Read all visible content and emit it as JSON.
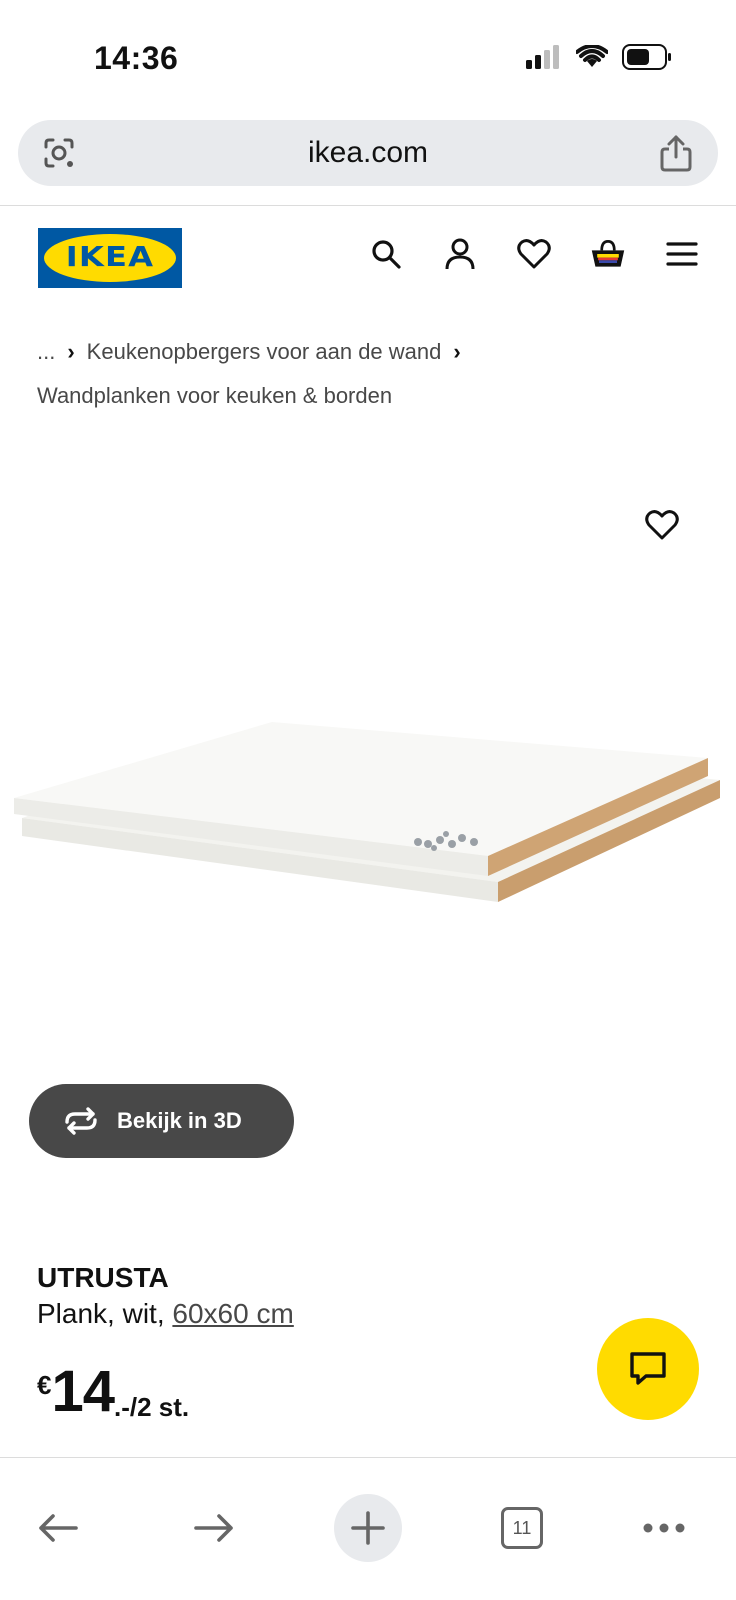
{
  "status_bar": {
    "time": "14:36"
  },
  "browser": {
    "url": "ikea.com",
    "tab_count": "11"
  },
  "header": {
    "logo_text": "IKEA",
    "icons": [
      "search-icon",
      "account-icon",
      "favorites-heart-icon",
      "shopping-basket-icon",
      "menu-icon"
    ]
  },
  "breadcrumb": {
    "ellipsis": "...",
    "category": "Keukenopbergers voor aan de wand",
    "current": "Wandplanken voor keuken & borden"
  },
  "product": {
    "view_3d_label": "Bekijk in 3D",
    "name": "UTRUSTA",
    "description_prefix": "Plank, wit,",
    "size": "60x60 cm",
    "price_currency": "€",
    "price_integer": "14",
    "price_suffix": ".-/2 st."
  },
  "colors": {
    "ikea_blue": "#0058a3",
    "ikea_yellow": "#ffdb00",
    "button_dark": "#484848"
  }
}
